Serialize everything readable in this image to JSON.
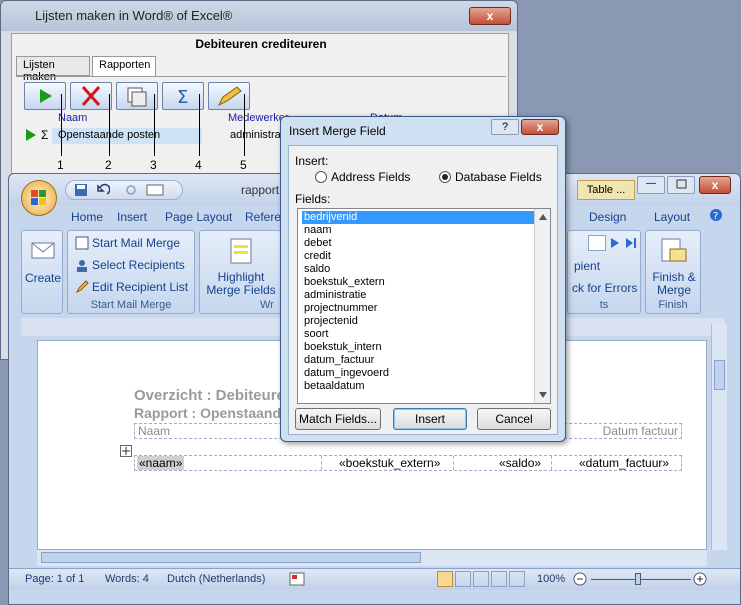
{
  "back_window": {
    "title": "Lijsten maken in Word® of Excel®",
    "close": "x",
    "heading": "Debiteuren crediteuren",
    "tabs": [
      "Lijsten maken",
      "Rapporten"
    ],
    "columns": {
      "naam": "Naam",
      "medewerker": "Medewerker",
      "datum": "Datum"
    },
    "row": {
      "sigma": "Σ",
      "name": "Openstaande posten",
      "medewerker": "administrati"
    },
    "callouts": [
      "1",
      "2",
      "3",
      "4",
      "5"
    ]
  },
  "word": {
    "title": "rapport1",
    "table_tab": "Table ...",
    "tabs": [
      "Home",
      "Insert",
      "Page Layout",
      "Referen",
      "Design",
      "Layout"
    ],
    "groups": {
      "create": "Create",
      "start_mail_merge": "Start Mail Merge",
      "select_recipients": "Select Recipients",
      "edit_recipient_list": "Edit Recipient List",
      "start_group_label": "Start Mail Merge",
      "highlight": "Highlight\nMerge Fields",
      "write_label": "Wr",
      "recipient": "pient",
      "check_errors": "ck for Errors",
      "finish": "Finish &\nMerge",
      "finish_label": "Finish",
      "results_label": "ts"
    },
    "doc": {
      "title1": "Overzicht : Debiteure",
      "title2": "Rapport : Openstaand",
      "header_naam": "Naam",
      "header_datum": "Datum factuur",
      "fields": [
        "«naam»",
        "«boekstuk_extern»",
        "«saldo»",
        "«datum_factuur»"
      ]
    },
    "status": {
      "page": "Page: 1 of 1",
      "words": "Words: 4",
      "lang": "Dutch (Netherlands)",
      "zoom": "100%"
    }
  },
  "dialog": {
    "title": "Insert Merge Field",
    "insert_label": "Insert:",
    "address_fields": "Address Fields",
    "database_fields": "Database Fields",
    "fields_label": "Fields:",
    "fields": [
      "bedrijvenid",
      "naam",
      "debet",
      "credit",
      "saldo",
      "boekstuk_extern",
      "administratie",
      "projectnummer",
      "projectenid",
      "soort",
      "boekstuk_intern",
      "datum_factuur",
      "datum_ingevoerd",
      "betaaldatum"
    ],
    "buttons": {
      "match": "Match Fields...",
      "insert": "Insert",
      "cancel": "Cancel"
    }
  }
}
